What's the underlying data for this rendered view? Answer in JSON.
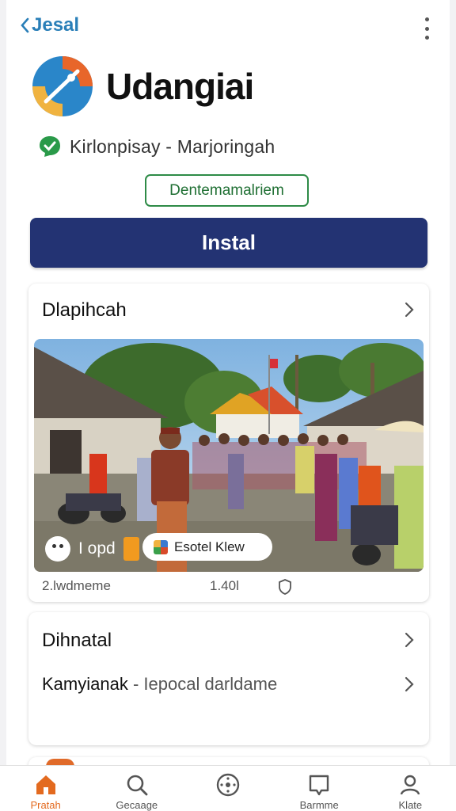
{
  "topbar": {
    "back_label": "Jesal"
  },
  "app": {
    "name": "Udangiai",
    "developer": "Kirlonpisay - Marjoringah",
    "tag": "Dentemamalriem",
    "install_label": "Instal"
  },
  "card1": {
    "title": "Dlapihcah",
    "photo_chip_count": "I opd",
    "photo_chip_label": "Esotel Klew",
    "meta_left": "2.lwdmeme",
    "meta_mid": "1.40l"
  },
  "card2": {
    "title": "Dihnatal",
    "row_title": "Kamyianak",
    "row_sub": "- Iepocal darldame"
  },
  "nav": {
    "items": [
      {
        "label": "Pratah",
        "icon": "home-icon"
      },
      {
        "label": "Gecaage",
        "icon": "search-icon"
      },
      {
        "label": "",
        "icon": "compass-icon"
      },
      {
        "label": "Barmme",
        "icon": "bookmark-icon"
      },
      {
        "label": "Klate",
        "icon": "profile-icon"
      }
    ]
  },
  "colors": {
    "accent_blue": "#233373",
    "back_link": "#2a7fb8",
    "tag_green": "#2e8b47",
    "nav_active": "#e36a1f"
  }
}
